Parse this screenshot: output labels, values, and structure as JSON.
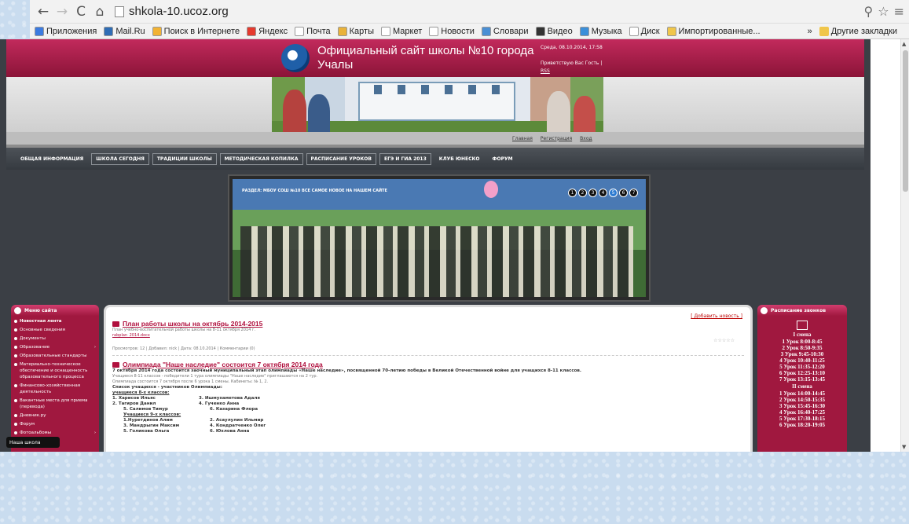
{
  "browser": {
    "url": "shkola-10.ucoz.org",
    "bookmarks": [
      {
        "label": "Приложения",
        "color": "#3c7be0"
      },
      {
        "label": "Mail.Ru",
        "color": "#2f6db5"
      },
      {
        "label": "Поиск в Интернете",
        "color": "#f2b233"
      },
      {
        "label": "Яндекс",
        "color": "#e53a2e"
      },
      {
        "label": "Почта",
        "color": "#ffffff"
      },
      {
        "label": "Карты",
        "color": "#e9b23a"
      },
      {
        "label": "Маркет",
        "color": "#ffffff"
      },
      {
        "label": "Новости",
        "color": "#ffffff"
      },
      {
        "label": "Словари",
        "color": "#4a8fd4"
      },
      {
        "label": "Видео",
        "color": "#333333"
      },
      {
        "label": "Музыка",
        "color": "#3b8fd9"
      },
      {
        "label": "Диск",
        "color": "#ffffff"
      },
      {
        "label": "Импортированные...",
        "color": "#f0c64b"
      }
    ],
    "overflow_label": "»",
    "other_bookmarks": "Другие закладки"
  },
  "site": {
    "title": "Официальный сайт школы №10 города Учалы",
    "date": "Среда, 08.10.2014, 17:58",
    "greeting": "Приветствую Вас Гость",
    "rss": "RSS",
    "sublinks": [
      "Главная",
      "Регистрация",
      "Вход"
    ],
    "menu": [
      {
        "label": "ОБЩАЯ ИНФОРМАЦИЯ",
        "boxed": false
      },
      {
        "label": "ШКОЛА СЕГОДНЯ",
        "boxed": true
      },
      {
        "label": "ТРАДИЦИИ ШКОЛЫ",
        "boxed": true
      },
      {
        "label": "МЕТОДИЧЕСКАЯ КОПИЛКА",
        "boxed": true
      },
      {
        "label": "РАСПИСАНИЕ УРОКОВ",
        "boxed": true
      },
      {
        "label": "ЕГЭ И ГИА 2013",
        "boxed": true
      },
      {
        "label": "КЛУБ ЮНЕСКО",
        "boxed": false
      },
      {
        "label": "ФОРУМ",
        "boxed": false
      }
    ],
    "slider": {
      "caption": "РАЗДЕЛ: МБОУ СОШ №10   ВСЕ САМОЕ НОВОЕ НА НАШЕМ САЙТЕ",
      "dots": [
        "1",
        "2",
        "3",
        "4",
        "5",
        "6",
        "7"
      ],
      "active_dot": 4
    }
  },
  "left_menu": {
    "title": "Меню сайта",
    "items": [
      {
        "label": "Новостная лента",
        "bold": true,
        "arrow": false
      },
      {
        "label": "Основные сведения",
        "bold": false,
        "arrow": false
      },
      {
        "label": "Документы",
        "bold": false,
        "arrow": false
      },
      {
        "label": "Образование",
        "bold": false,
        "arrow": true
      },
      {
        "label": "Образовательные стандарты",
        "bold": false,
        "arrow": false
      },
      {
        "label": "Материально-техническое обеспечение и оснащенность образовательного процесса",
        "bold": false,
        "arrow": false
      },
      {
        "label": "Финансово-хозяйственная деятельность",
        "bold": false,
        "arrow": false
      },
      {
        "label": "Вакантные места для приема (перевода)",
        "bold": false,
        "arrow": false
      },
      {
        "label": "Дневник.ру",
        "bold": false,
        "arrow": false
      },
      {
        "label": "Форум",
        "bold": false,
        "arrow": false
      },
      {
        "label": "Фотоальбомы",
        "bold": false,
        "arrow": true
      }
    ],
    "tooltip": "Наша школа"
  },
  "right_panel": {
    "title": "Расписание звонков",
    "shift1": "I смена",
    "shift1_lessons": [
      "1 Урок 8:00-8:45",
      "2 Урок 8:50-9:35",
      "3 Урок 9:45-10:30",
      "4 Урок 10:40-11:25",
      "5 Урок 11:35-12:20",
      "6 Урок 12:25-13:10",
      "7 Урок 13:15-13:45"
    ],
    "shift2": "II смена",
    "shift2_lessons": [
      "1 Урок 14:00-14:45",
      "2 Урок 14:50-15:35",
      "3 Урок 15:45-16:30",
      "4 Урок 16:40-17:25",
      "5 Урок 17:30-18:15",
      "6 Урок 18:20-19:05"
    ]
  },
  "main": {
    "add_news": "[ Добавить новость ]",
    "news1": {
      "title": "План работы школы на октябрь 2014-2015",
      "desc": "План учебно-воспитательной работы школы на 8-11 октября 2014 г.",
      "file": "rabplan_2014.docx",
      "meta": "Просмотров: 12 | Добавил: nick | Дата: 08.10.2014 | Комментарии (0)",
      "stars": "☆☆☆☆☆"
    },
    "news2": {
      "title": "Олимпиада \"Наше наследие\" состоится 7 октября 2014 года",
      "lead": "7 октября 2014 года состоится заочный муниципальный этап олимпиады «Наше наследие», посвященной 70-летию победы в Великой Отечественной войне для учащихся 8-11 классов.",
      "line2": "Учащиеся 8-11 классов - победители 1 тура олимпиады \"Наше наследие\" приглашаются на 2 тур.",
      "line3": "Олимпиада состоится 7 октября после 6 урока 1 смены. Кабинеты: № 1, 2.",
      "list_title": "Список учащихся - участников Олимпиады:",
      "grade8": "учащиеся 8-х классов:",
      "pairs8": [
        [
          "1. Харисов Ильяс",
          "3. Ишмухаметова Адаля"
        ],
        [
          "2. Тагиров Данил",
          "4. Гученко Анна"
        ],
        [
          "5. Салимов Тимур",
          "6. Казарина Флора"
        ]
      ],
      "grade9": "Учащиеся 9-х классов:",
      "pairs9": [
        [
          "1.Нуретдинов Алим",
          "2. Асаулулин Ильмир"
        ],
        [
          "3. Мандрыгин Максим",
          "4. Кондратченко Олег"
        ],
        [
          "5. Голикова Ольга",
          "6. Юхлова Анна"
        ]
      ]
    }
  }
}
